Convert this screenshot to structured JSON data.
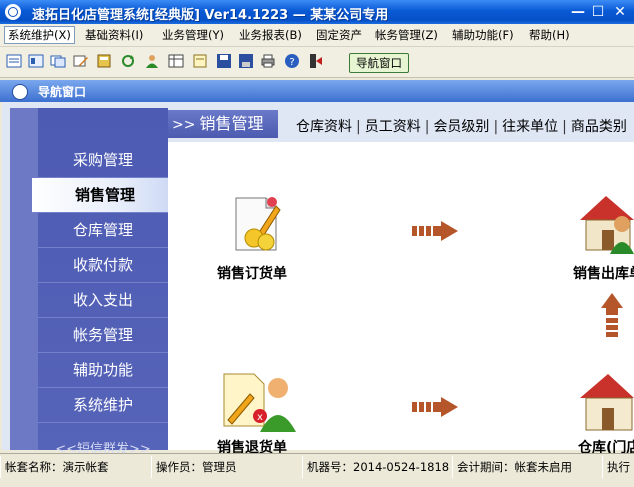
{
  "window": {
    "title": "速拓日化店管理系统[经典版] Ver14.1223 — 某某公司专用",
    "minimize": "—",
    "maximize": "☐",
    "close": "✕"
  },
  "menu": [
    "系统维护(X)",
    "基础资料(I)",
    "业务管理(Y)",
    "业务报表(B)",
    "固定资产",
    "帐务管理(Z)",
    "辅助功能(F)",
    "帮助(H)"
  ],
  "toolbar": {
    "icons": [
      "report-icon",
      "list-icon",
      "window-icon",
      "edit-icon",
      "book-icon",
      "refresh-icon",
      "user-icon",
      "grid-icon",
      "note-icon",
      "save-icon",
      "disk-icon",
      "print-icon",
      "help-icon",
      "exit-icon"
    ],
    "nav_window_label": "导航窗口"
  },
  "panel": {
    "title": "导航窗口"
  },
  "sidebar": {
    "items": [
      {
        "label": "采购管理",
        "active": false
      },
      {
        "label": "销售管理",
        "active": true
      },
      {
        "label": "仓库管理",
        "active": false
      },
      {
        "label": "收款付款",
        "active": false
      },
      {
        "label": "收入支出",
        "active": false
      },
      {
        "label": "帐务管理",
        "active": false
      },
      {
        "label": "辅助功能",
        "active": false
      },
      {
        "label": "系统维护",
        "active": false
      }
    ],
    "more": "<<短信群发>>"
  },
  "tabs": {
    "current_prefix": ">>",
    "current": "销售管理",
    "links": [
      "仓库资料",
      "员工资料",
      "会员级别",
      "往来单位",
      "商品类别"
    ]
  },
  "functions": {
    "sales_order": "销售订货单",
    "sales_outbound": "销售出库单",
    "sales_return": "销售退货单",
    "warehouse": "仓库(门店)"
  },
  "status": {
    "account": "帐套名称：演示帐套",
    "operator": "操作员：管理员",
    "machine": "机器号：2014-0524-1818",
    "period": "会计期间：帐套未启用",
    "extra": "执行"
  },
  "colors": {
    "title_blue": "#0a5ad6",
    "sidebar_bg": "#4e5bb3",
    "arrow": "#b4552a"
  }
}
